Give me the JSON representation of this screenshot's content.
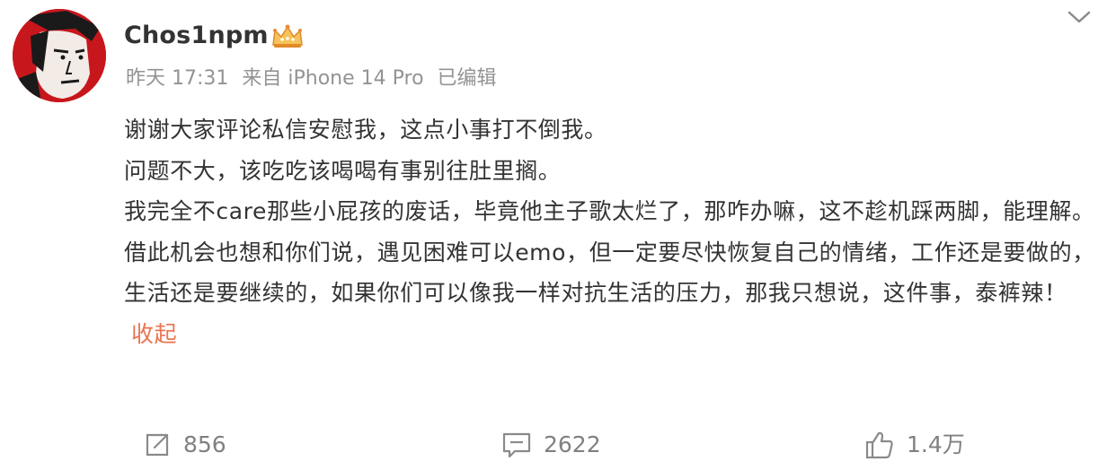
{
  "post": {
    "username": "Chos1npm",
    "meta": {
      "time": "昨天 17:31",
      "source": "来自 iPhone 14 Pro",
      "edited": "已编辑"
    },
    "paragraphs": [
      "谢谢大家评论私信安慰我，这点小事打不倒我。",
      "问题不大，该吃吃该喝喝有事别往肚里搁。",
      "我完全不care那些小屁孩的废话，毕竟他主子歌太烂了，那咋办嘛，这不趁机踩两脚，能理解。",
      "借此机会也想和你们说，遇见困难可以emo，但一定要尽快恢复自己的情绪，工作还是要做的，生活还是要继续的，如果你们可以像我一样对抗生活的压力，那我只想说，这件事，泰裤辣！"
    ],
    "collapse_label": "收起",
    "actions": {
      "repost_count": "856",
      "comment_count": "2622",
      "like_count": "1.4万"
    },
    "colors": {
      "link": "#eb7350",
      "meta": "#939393",
      "text": "#333333"
    }
  }
}
